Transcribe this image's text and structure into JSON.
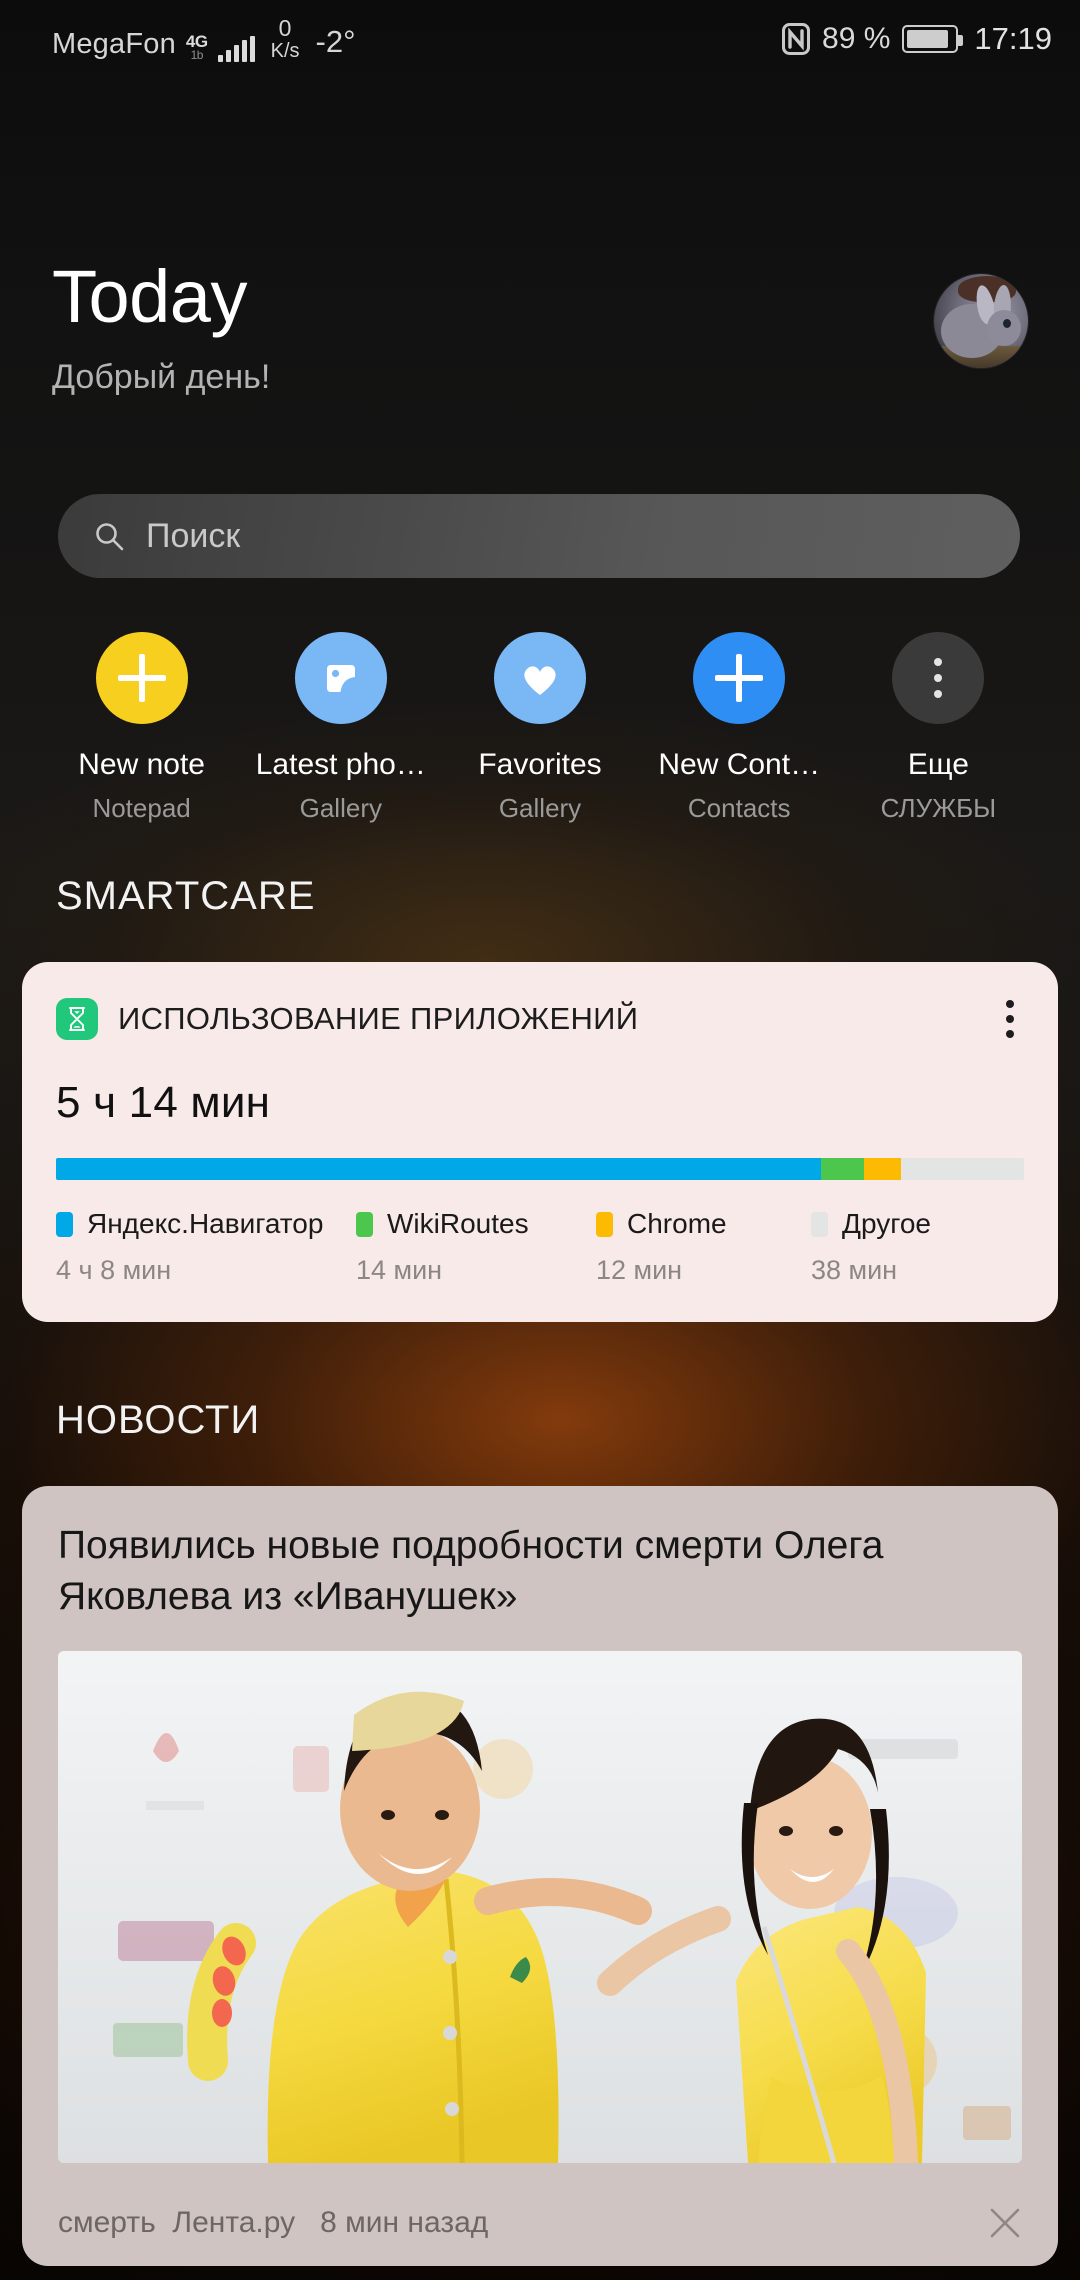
{
  "status_bar": {
    "carrier": "MegaFon",
    "network_type": "4G",
    "network_sub": "1b",
    "speed_value": "0",
    "speed_unit": "K/s",
    "temperature": "-2°",
    "nfc_icon": "nfc-icon",
    "battery_percent": "89 %",
    "battery_level": 89,
    "clock": "17:19"
  },
  "header": {
    "title": "Today",
    "greeting": "Добрый день!",
    "avatar_alt": "rabbit-avatar"
  },
  "search": {
    "placeholder": "Поиск",
    "icon": "search-icon"
  },
  "shortcuts": [
    {
      "label": "New note",
      "sublabel": "Notepad",
      "icon": "plus-icon",
      "bg": "#f7cf1e"
    },
    {
      "label": "Latest pho…",
      "sublabel": "Gallery",
      "icon": "photo-icon",
      "bg": "#7ab8f5"
    },
    {
      "label": "Favorites",
      "sublabel": "Gallery",
      "icon": "heart-icon",
      "bg": "#7ab8f5"
    },
    {
      "label": "New Cont…",
      "sublabel": "Contacts",
      "icon": "plus-icon",
      "bg": "#2f8ef4"
    },
    {
      "label": "Еще",
      "sublabel": "СЛУЖБЫ",
      "icon": "more-dots-icon",
      "bg": "#3a3a3a"
    }
  ],
  "smartcare": {
    "section_title": "SMARTCARE",
    "card_icon": "hourglass-icon",
    "card_title": "ИСПОЛЬЗОВАНИЕ ПРИЛОЖЕНИЙ",
    "menu_icon": "kebab-menu-icon",
    "total_time": "5 ч 14 мин"
  },
  "news": {
    "section_title": "НОВОСТИ",
    "headline": "Появились новые подробности смерти Олега Яковлева из «Иванушек»",
    "tag": "смерть",
    "source": "Лента.ру",
    "time_ago": "8 мин назад",
    "close_icon": "close-icon"
  },
  "chart_data": {
    "type": "bar",
    "title": "ИСПОЛЬЗОВАНИЕ ПРИЛОЖЕНИЙ",
    "subtitle": "5 ч 14 мин",
    "orientation": "horizontal-stacked",
    "total_minutes": 314,
    "categories": [
      "Яндекс.Навигатор",
      "WikiRoutes",
      "Chrome",
      "Другое"
    ],
    "values": [
      248,
      14,
      12,
      38
    ],
    "value_labels": [
      "4 ч 8 мин",
      "14 мин",
      "12 мин",
      "38 мин"
    ],
    "percentages": [
      79.0,
      4.5,
      3.8,
      12.1
    ],
    "colors": [
      "#00a8e8",
      "#4cc64c",
      "#fcba03",
      "#e3e4e4"
    ],
    "legend": "bottom",
    "grid": false,
    "xlabel": "",
    "ylabel": ""
  }
}
